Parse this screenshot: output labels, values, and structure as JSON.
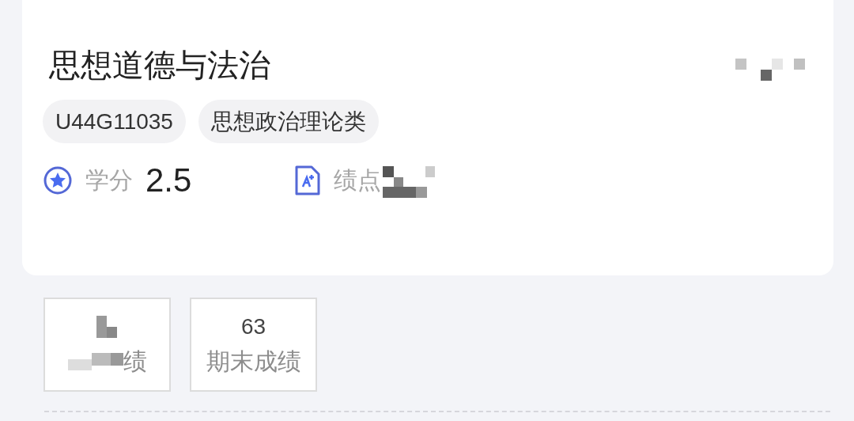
{
  "course": {
    "title": "思想道德与法治",
    "tags": [
      "U44G11035",
      "思想政治理论类"
    ],
    "credit": {
      "label": "学分",
      "value": "2.5"
    },
    "gpa": {
      "label": "绩点"
    }
  },
  "scores": [
    {
      "label": "绩",
      "redacted": true
    },
    {
      "value": "63",
      "label": "期末成绩",
      "redacted": false
    }
  ]
}
